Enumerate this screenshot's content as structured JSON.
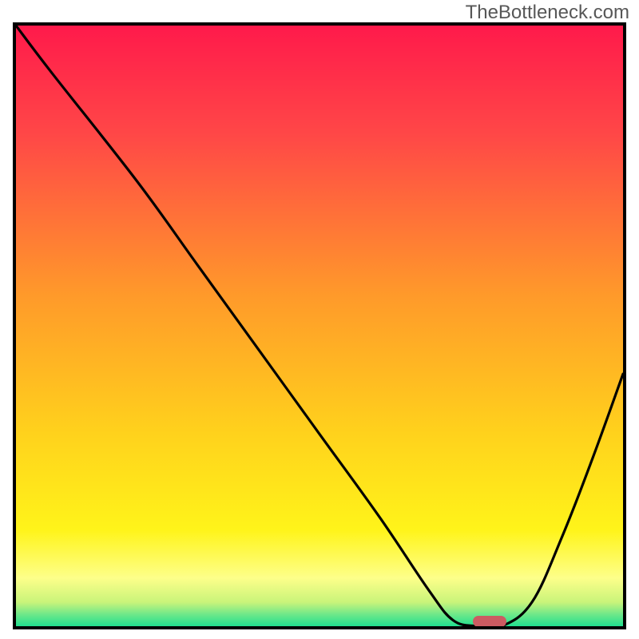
{
  "watermark": "TheBottleneck.com",
  "colors": {
    "frame_border": "#000000",
    "curve": "#000000",
    "marker": "#cc5b62",
    "gradient_stops": [
      {
        "offset": 0,
        "color": "#ff1a4b"
      },
      {
        "offset": 18,
        "color": "#ff4747"
      },
      {
        "offset": 45,
        "color": "#ff9a2a"
      },
      {
        "offset": 68,
        "color": "#ffd21c"
      },
      {
        "offset": 84,
        "color": "#fff41a"
      },
      {
        "offset": 92,
        "color": "#fdff8a"
      },
      {
        "offset": 96,
        "color": "#c9f47a"
      },
      {
        "offset": 98,
        "color": "#6fe889"
      },
      {
        "offset": 100,
        "color": "#21e08f"
      }
    ]
  },
  "chart_data": {
    "type": "line",
    "title": "",
    "xlabel": "",
    "ylabel": "",
    "xlim": [
      0,
      100
    ],
    "ylim": [
      0,
      100
    ],
    "series": [
      {
        "name": "bottleneck-curve",
        "x": [
          0,
          6,
          20,
          30,
          40,
          50,
          60,
          68,
          72,
          76,
          80,
          85,
          90,
          95,
          100
        ],
        "y": [
          100,
          92,
          74,
          60,
          46,
          32,
          18,
          6,
          1,
          0,
          0,
          4,
          15,
          28,
          42
        ]
      }
    ],
    "marker": {
      "x": 78,
      "y": 0.8
    }
  }
}
